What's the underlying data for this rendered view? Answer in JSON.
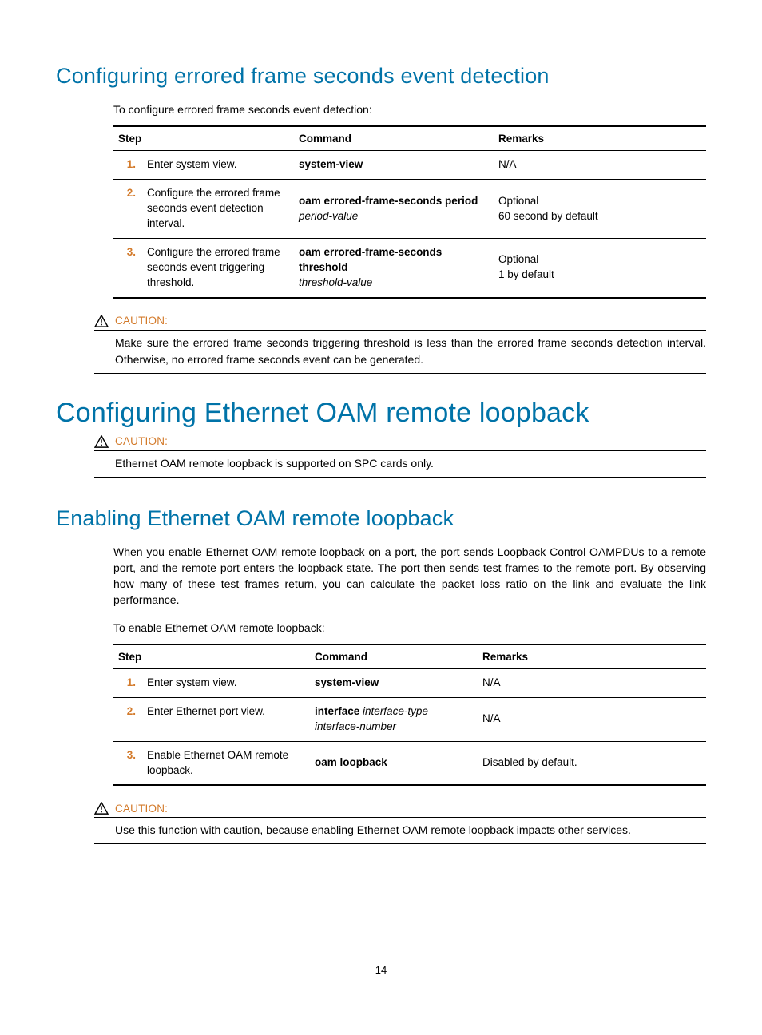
{
  "sec1": {
    "heading": "Configuring errored frame seconds event detection",
    "intro": "To configure errored frame seconds event detection:",
    "table": {
      "headers": {
        "step": "Step",
        "command": "Command",
        "remarks": "Remarks"
      },
      "rows": [
        {
          "num": "1.",
          "desc": "Enter system view.",
          "cmd_bold": "system-view",
          "cmd_italic": "",
          "remarks1": "N/A",
          "remarks2": ""
        },
        {
          "num": "2.",
          "desc": "Configure the errored frame seconds event detection interval.",
          "cmd_bold": "oam errored-frame-seconds period",
          "cmd_italic": "period-value",
          "remarks1": "Optional",
          "remarks2": "60 second by default"
        },
        {
          "num": "3.",
          "desc": "Configure the errored frame seconds event triggering threshold.",
          "cmd_bold": "oam errored-frame-seconds threshold",
          "cmd_italic": "threshold-value",
          "remarks1": "Optional",
          "remarks2": "1 by default"
        }
      ]
    },
    "caution": {
      "label": "CAUTION:",
      "text": "Make sure the errored frame seconds triggering threshold is less than the errored frame seconds detection interval. Otherwise, no errored frame seconds event can be generated."
    }
  },
  "sec2": {
    "heading": "Configuring Ethernet OAM remote loopback",
    "caution": {
      "label": "CAUTION:",
      "text": "Ethernet OAM remote loopback is supported on SPC cards only."
    }
  },
  "sec3": {
    "heading": "Enabling Ethernet OAM remote loopback",
    "para": "When you enable Ethernet OAM remote loopback on a port, the port sends Loopback Control OAMPDUs to a remote port, and the remote port enters the loopback state. The port then sends test frames to the remote port. By observing how many of these test frames return, you can calculate the packet loss ratio on the link and evaluate the link performance.",
    "intro": "To enable Ethernet OAM remote loopback:",
    "table": {
      "headers": {
        "step": "Step",
        "command": "Command",
        "remarks": "Remarks"
      },
      "rows": [
        {
          "num": "1.",
          "desc": "Enter system view.",
          "cmd_bold": "system-view",
          "cmd_italic": "",
          "remarks1": "N/A",
          "remarks2": ""
        },
        {
          "num": "2.",
          "desc": "Enter Ethernet port view.",
          "cmd_bold": "interface",
          "cmd_italic": "interface-type interface-number",
          "remarks1": "N/A",
          "remarks2": ""
        },
        {
          "num": "3.",
          "desc": "Enable Ethernet OAM remote loopback.",
          "cmd_bold": "oam loopback",
          "cmd_italic": "",
          "remarks1": "Disabled by default.",
          "remarks2": ""
        }
      ]
    },
    "caution": {
      "label": "CAUTION:",
      "text": "Use this function with caution, because enabling Ethernet OAM remote loopback impacts other services."
    }
  },
  "page_number": "14"
}
